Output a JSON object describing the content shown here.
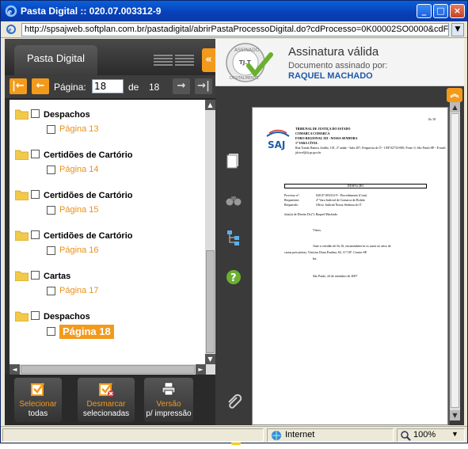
{
  "window": {
    "title": "Pasta Digital :: 020.07.003312-9",
    "url": "http://spsajweb.softplan.com.br/pastadigital/abrirPastaProcessoDigital.do?cdProcesso=0K00002SO0000&cdFor"
  },
  "left_panel": {
    "tab_label": "Pasta Digital",
    "pager": {
      "label": "Página:",
      "current": "18",
      "of_label": "de",
      "total": "18"
    },
    "tree": [
      {
        "label": "Despachos",
        "page": "Página 13",
        "selected": false
      },
      {
        "label": "Certidões de Cartório",
        "page": "Página 14",
        "selected": false
      },
      {
        "label": "Certidões de Cartório",
        "page": "Página 15",
        "selected": false
      },
      {
        "label": "Certidões de Cartório",
        "page": "Página 16",
        "selected": false
      },
      {
        "label": "Cartas",
        "page": "Página 17",
        "selected": false
      },
      {
        "label": "Despachos",
        "page": "Página 18",
        "selected": true
      }
    ],
    "actions": {
      "select_all": {
        "line1": "Selecionar",
        "line2": "todas"
      },
      "deselect": {
        "line1": "Desmarcar",
        "line2": "selecionadas"
      },
      "print": {
        "line1": "Versão",
        "line2": "p/ impressão"
      }
    }
  },
  "signature": {
    "title": "Assinatura válida",
    "subtitle": "Documento assinado por:",
    "signer": "RAQUEL MACHADO",
    "seal_text_top": "ASSINADO",
    "seal_text_bottom": "DIGITALMENTE",
    "seal_center": "TJ.T"
  },
  "document": {
    "page_no": "fls 18",
    "header_lines": [
      "TRIBUNAL DE JUSTIÇA DO ESTADO",
      "COMARCA COMARCA",
      "FORO REGIONAL XII - NOSSA SENHORA",
      "1ª VARA CÍVEL",
      "Rua Tomás Ramos Jordão, 101, 2º andar - Sala 207, Freguesia do Ó - CEP 02733-000, Fone: 0, São Paulo-SP - E-mail:",
      "jdcivel@tj.sp.gov.br"
    ],
    "section": "DESPACHO",
    "fields": [
      {
        "k": "Processo nº:",
        "v": "020.07.003312-9 - Procedimento (Com)"
      },
      {
        "k": "Requerente:",
        "v": "2º Vara Judicial de Comarca de Bolsão"
      },
      {
        "k": "Requerido:",
        "v": "Ofício Judicial Nossa Senhora do Ó"
      }
    ],
    "judge_line": "Juiz(a) de Direito Dr.(ª). Raquel Machado",
    "body": [
      "Vistos.",
      "Ante a certidão de fls.16, encaminhem-se os autos ao setor de",
      "cartas precatórias, Vinícius Dona Paulina, 82, 11º/18º, Centro-SP.",
      "Int.",
      "São Paulo, 24 de setembro de 2007"
    ]
  },
  "statusbar": {
    "zone": "Internet",
    "zoom": "100%"
  }
}
